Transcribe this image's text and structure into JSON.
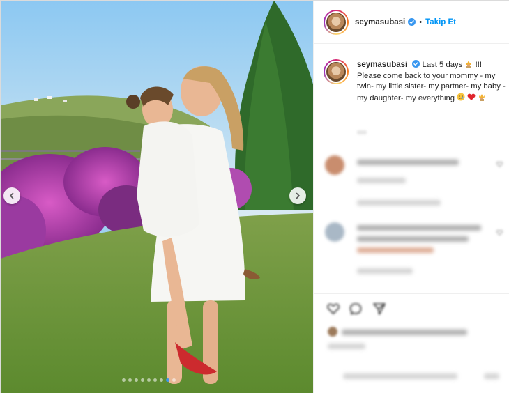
{
  "post": {
    "author": {
      "username": "seymasubasi",
      "verified": true,
      "follow_label": "Takip Et",
      "separator": "•"
    },
    "caption": {
      "username": "seymasubasi",
      "text_part1": "Last 5 days",
      "text_part2": "!!! Please come back to your mommy - my twin- my little sister- my partner- my baby - my daughter- my everything",
      "emojis": [
        "princess-emoji",
        "crying-face-emoji",
        "red-heart-emoji",
        "princess-emoji"
      ]
    },
    "carousel": {
      "slide_count": 9,
      "active_index": 7
    },
    "colors": {
      "link_blue": "#0095f6",
      "verified_blue": "#3897f0",
      "text": "#262626",
      "border": "#efefef"
    }
  },
  "icons": {
    "prev": "chevron-left-icon",
    "next": "chevron-right-icon",
    "verified": "verified-badge-icon",
    "like": "heart-icon",
    "comment": "comment-icon",
    "share": "share-icon"
  }
}
